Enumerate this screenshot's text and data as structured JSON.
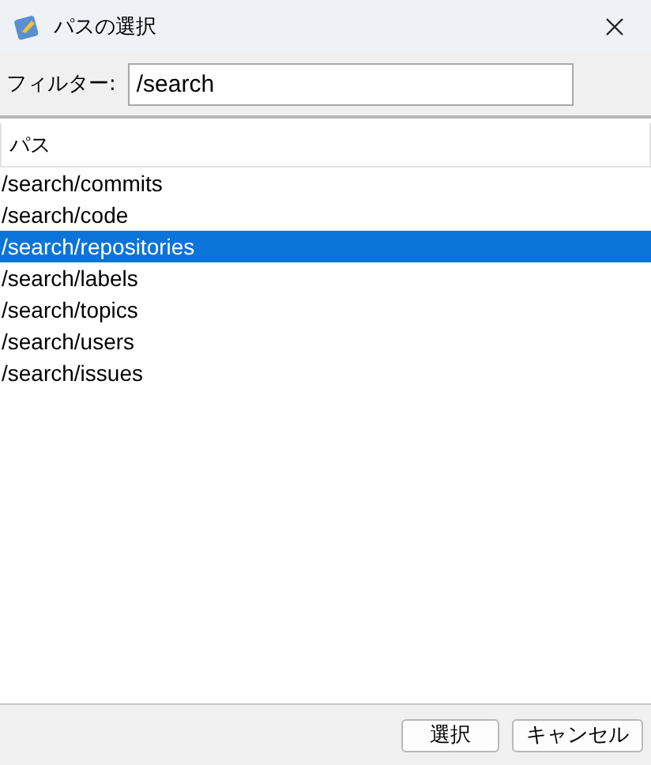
{
  "window": {
    "title": "パスの選択"
  },
  "filter": {
    "label": "フィルター:",
    "value": "/search"
  },
  "table": {
    "columns": [
      "パス"
    ],
    "rows": [
      {
        "path": "/search/commits",
        "selected": false
      },
      {
        "path": "/search/code",
        "selected": false
      },
      {
        "path": "/search/repositories",
        "selected": true
      },
      {
        "path": "/search/labels",
        "selected": false
      },
      {
        "path": "/search/topics",
        "selected": false
      },
      {
        "path": "/search/users",
        "selected": false
      },
      {
        "path": "/search/issues",
        "selected": false
      }
    ]
  },
  "buttons": [
    "選択",
    "キャンセル"
  ]
}
